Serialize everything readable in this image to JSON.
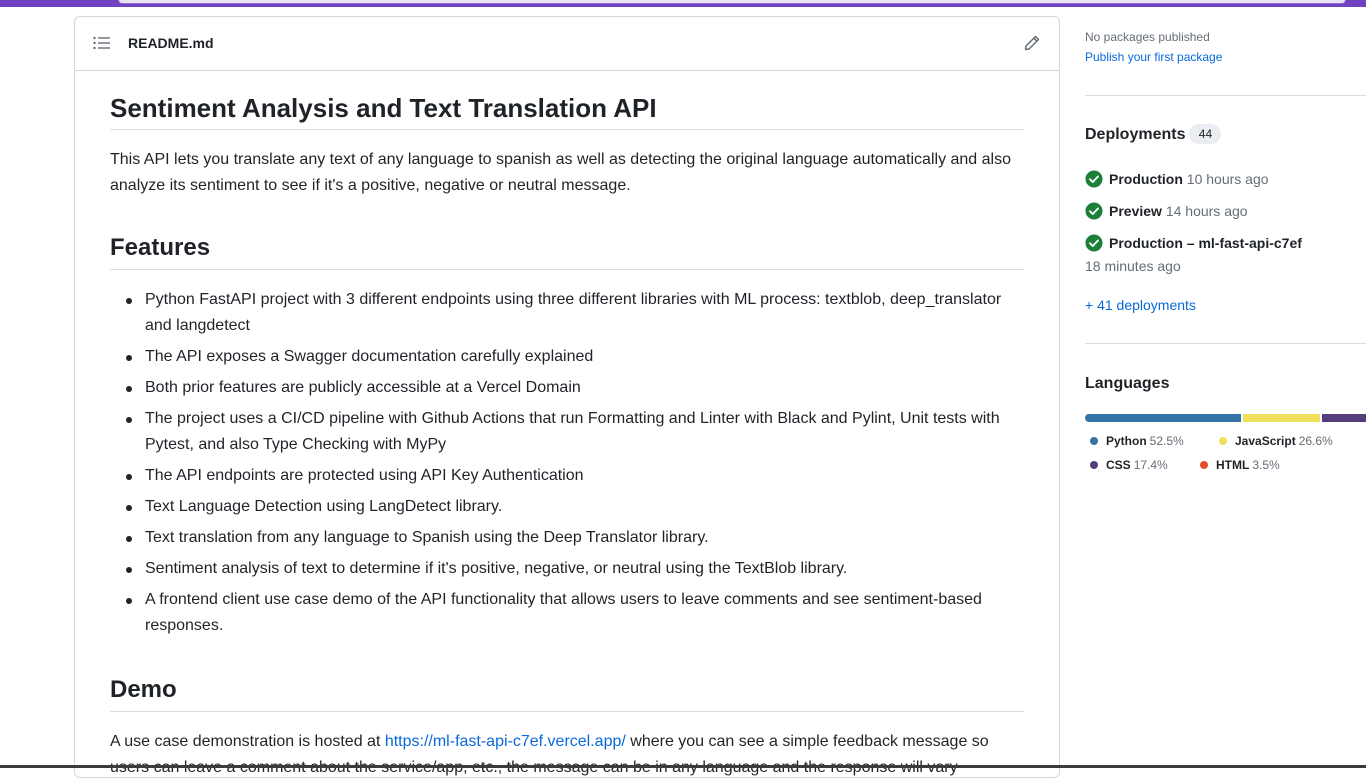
{
  "readme": {
    "filename": "README.md",
    "title": "Sentiment Analysis and Text Translation API",
    "intro": "This API lets you translate any text of any language to spanish as well as detecting the original language automatically and also analyze its sentiment to see if it's a positive, negative or neutral message.",
    "features_heading": "Features",
    "features": [
      "Python FastAPI project with 3 different endpoints using three different libraries with ML process: textblob, deep_translator and langdetect",
      "The API exposes a Swagger documentation carefully explained",
      "Both prior features are publicly accessible at a Vercel Domain",
      "The project uses a CI/CD pipeline with Github Actions that run Formatting and Linter with Black and Pylint, Unit tests with Pytest, and also Type Checking with MyPy",
      "The API endpoints are protected using API Key Authentication",
      "Text Language Detection using LangDetect library.",
      "Text translation from any language to Spanish using the Deep Translator library.",
      "Sentiment analysis of text to determine if it's positive, negative, or neutral using the TextBlob library.",
      "A frontend client use case demo of the API functionality that allows users to leave comments and see sentiment-based responses."
    ],
    "demo_heading": "Demo",
    "demo_prefix": "A use case demonstration is hosted at ",
    "demo_link": "https://ml-fast-api-c7ef.vercel.app/",
    "demo_suffix": " where you can see a simple feedback message so users can leave a comment about the service/app, etc., the message can be in any language and the response will vary"
  },
  "sidebar": {
    "packages": {
      "none_text": "No packages published",
      "publish_link": "Publish your first package"
    },
    "deployments": {
      "heading": "Deployments",
      "count": "44",
      "items": [
        {
          "name": "Production",
          "time": "10 hours ago"
        },
        {
          "name": "Preview",
          "time": "14 hours ago"
        },
        {
          "name": "Production – ml-fast-api-c7ef",
          "time": "18 minutes ago"
        }
      ],
      "more_link": "+ 41 deployments",
      "status_color": "#1a7f37"
    },
    "languages": {
      "heading": "Languages",
      "items": [
        {
          "name": "Python",
          "percent": "52.5%",
          "value": 52.5,
          "color": "#3572A5"
        },
        {
          "name": "JavaScript",
          "percent": "26.6%",
          "value": 26.6,
          "color": "#f1e05a"
        },
        {
          "name": "CSS",
          "percent": "17.4%",
          "value": 17.4,
          "color": "#563d7c"
        },
        {
          "name": "HTML",
          "percent": "3.5%",
          "value": 3.5,
          "color": "#e34c26"
        }
      ]
    }
  }
}
